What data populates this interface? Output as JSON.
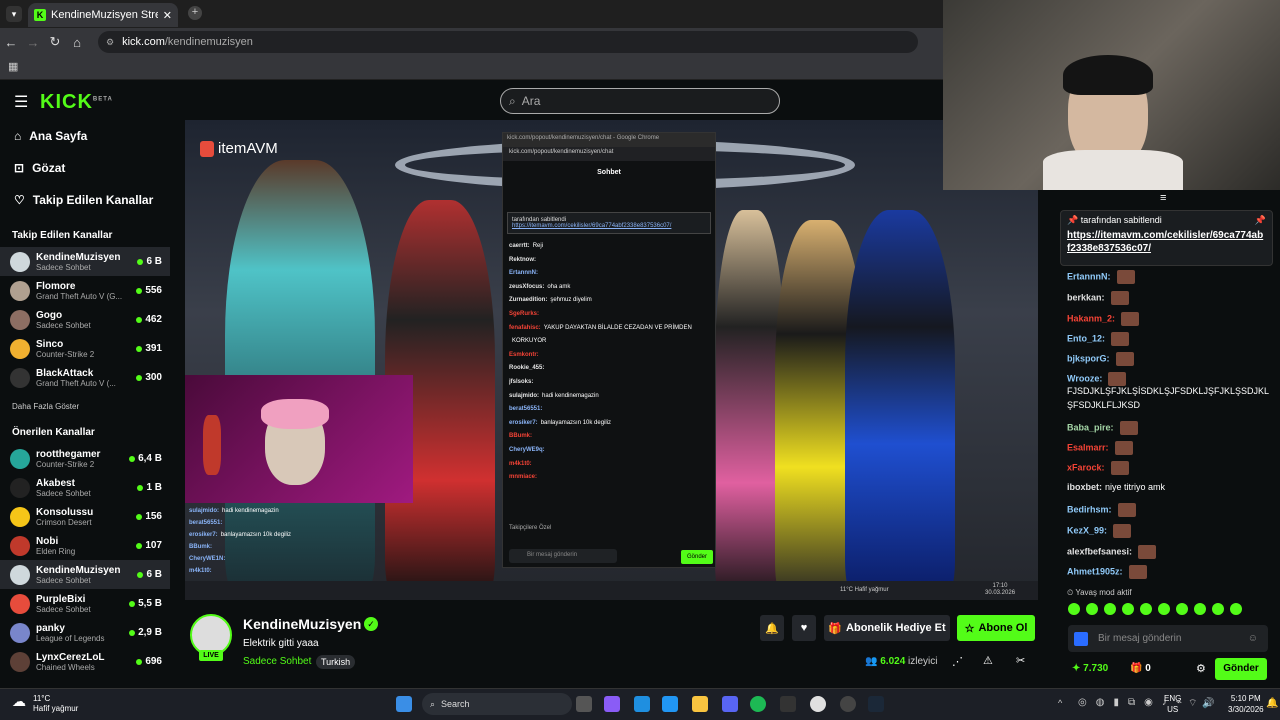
{
  "browser": {
    "tab_title": "KendineMuzisyen Stream - Wat",
    "url_domain": "kick.com",
    "url_path": "/kendinemuzisyen"
  },
  "header": {
    "logo": "KICK",
    "logo_badge": "BETA",
    "search_placeholder": "Ara"
  },
  "sidebar": {
    "nav": [
      {
        "label": "Ana Sayfa",
        "icon": "home-icon"
      },
      {
        "label": "Gözat",
        "icon": "browse-icon"
      },
      {
        "label": "Takip Edilen Kanallar",
        "icon": "heart-icon"
      }
    ],
    "followed_heading": "Takip Edilen Kanallar",
    "followed": [
      {
        "name": "KendineMuzisyen",
        "game": "Sadece Sohbet",
        "viewers": "6 B",
        "color": "#cfd8dc",
        "active": true
      },
      {
        "name": "Flomore",
        "game": "Grand Theft Auto V (G...",
        "viewers": "556",
        "color": "#b0a090"
      },
      {
        "name": "Gogo",
        "game": "Sadece Sohbet",
        "viewers": "462",
        "color": "#8d6e63"
      },
      {
        "name": "Sinco",
        "game": "Counter-Strike 2",
        "viewers": "391",
        "color": "#f0b030"
      },
      {
        "name": "BlackAttack",
        "game": "Grand Theft Auto V (...",
        "viewers": "300",
        "color": "#333333"
      }
    ],
    "more_label": "Daha Fazla Göster",
    "recommended_heading": "Önerilen Kanallar",
    "recommended": [
      {
        "name": "rootthegamer",
        "game": "Counter-Strike 2",
        "viewers": "6,4 B",
        "color": "#26a69a"
      },
      {
        "name": "Akabest",
        "game": "Sadece Sohbet",
        "viewers": "1 B",
        "color": "#222222"
      },
      {
        "name": "Konsolussu",
        "game": "Crimson Desert",
        "viewers": "156",
        "color": "#f5c518"
      },
      {
        "name": "Nobi",
        "game": "Elden Ring",
        "viewers": "107",
        "color": "#c0392b"
      },
      {
        "name": "KendineMuzisyen",
        "game": "Sadece Sohbet",
        "viewers": "6 B",
        "color": "#cfd8dc",
        "active": true
      },
      {
        "name": "PurpleBixi",
        "game": "Sadece Sohbet",
        "viewers": "5,5 B",
        "color": "#e74c3c"
      },
      {
        "name": "panky",
        "game": "League of Legends",
        "viewers": "2,9 B",
        "color": "#7986cb"
      },
      {
        "name": "LynxCerezLoL",
        "game": "Chained Wheels",
        "viewers": "696",
        "color": "#5d4037"
      }
    ]
  },
  "video": {
    "brand": "itemAVM",
    "popout": {
      "title": "kick.com/popout/kendinemuzisyen/chat - Google Chrome",
      "url": "kick.com/popout/kendinemuzisyen/chat",
      "heading": "Sohbet",
      "pinned_by": "tarafından sabitlendi",
      "pinned_link": "https://itemavm.com/cekilisler/69ca774abf2338e837536c07/",
      "messages": [
        {
          "user": "caerrtt:",
          "text": "Reji",
          "color": "#e5e5e5"
        },
        {
          "user": "Rektnow:",
          "text": "",
          "color": "#e5e5e5"
        },
        {
          "user": "ErtannnN:",
          "text": "",
          "color": "#8ab4f8"
        },
        {
          "user": "zeusXfocus:",
          "text": "oha amk",
          "color": "#e5e5e5"
        },
        {
          "user": "Zurnaedition:",
          "text": "şehmuz diyelim",
          "color": "#e5e5e5"
        },
        {
          "user": "SgeRurks:",
          "text": "",
          "color": "#f44336"
        },
        {
          "user": "fenafahisc:",
          "text": "YAKUP DAYAKTAN BİLALDE CEZADAN VE PRİMDEN",
          "color": "#f44336"
        },
        {
          "user": "",
          "text": "KORKUYOR",
          "color": "#e5e5e5"
        },
        {
          "user": "Esmkontr:",
          "text": "",
          "color": "#f44336"
        },
        {
          "user": "Rookie_455:",
          "text": "",
          "color": "#e5e5e5"
        },
        {
          "user": "jfslsoks:",
          "text": "",
          "color": "#e5e5e5"
        },
        {
          "user": "sulajmido:",
          "text": "hadi kendinemagazin",
          "color": "#e5e5e5"
        },
        {
          "user": "berat56551:",
          "text": "",
          "color": "#8ab4f8"
        },
        {
          "user": "erosiker7:",
          "text": "banlayamazsın 10k degiliz",
          "color": "#8ab4f8"
        },
        {
          "user": "BBumk:",
          "text": "",
          "color": "#f44336"
        },
        {
          "user": "CheryWE9q:",
          "text": "",
          "color": "#8ab4f8"
        },
        {
          "user": "m4k1t0:",
          "text": "",
          "color": "#f44336"
        },
        {
          "user": "mnmiace:",
          "text": "",
          "color": "#f44336"
        }
      ],
      "input_placeholder": "Bir mesaj gönderin",
      "send": "Gönder",
      "subs_label": "Takipçilere Özel"
    },
    "overlay_chat": [
      {
        "user": "sulajmido:",
        "text": "hadi kendinemagazin"
      },
      {
        "user": "berat56551:",
        "text": ""
      },
      {
        "user": "erosiker7:",
        "text": "banlayamazsın 10k degiliz"
      },
      {
        "user": "BBumk:",
        "text": ""
      },
      {
        "user": "CheryWE1N:",
        "text": ""
      },
      {
        "user": "m4k1t0:",
        "text": ""
      }
    ],
    "inner_taskbar": {
      "weather": "11°C   Hafif yağmur",
      "time": "17:10",
      "date": "30.03.2026"
    }
  },
  "stream": {
    "name": "KendineMuzisyen",
    "live": "LIVE",
    "title": "Elektrik gitti yaaa",
    "category": "Sadece Sohbet",
    "tag": "Turkish",
    "gift_sub": "Abonelik Hediye Et",
    "subscribe": "Abone Ol",
    "viewers": "6.024",
    "viewers_label": "izleyici"
  },
  "chat": {
    "pinned_by": "tarafından sabitlendi",
    "pinned_link": "https://itemavm.com/cekilisler/69ca774abf2338e837536c07/",
    "messages": [
      {
        "user": "ErtannnN:",
        "text": "",
        "color": "#90caf9",
        "top": 0
      },
      {
        "user": "berkkan:",
        "text": "",
        "color": "#e0e0e0"
      },
      {
        "user": "Hakanm_2:",
        "text": "",
        "color": "#f44336"
      },
      {
        "user": "Ento_12:",
        "text": "",
        "color": "#90caf9"
      },
      {
        "user": "bjksporG:",
        "text": "",
        "color": "#90caf9"
      },
      {
        "user": "Wrooze:",
        "text": "",
        "color": "#90caf9"
      },
      {
        "user": "",
        "text": "FJSDJKLŞFJKLŞİSDKLŞJFSDKLJŞFJKLŞSDJKL",
        "color": "#e0e0e0"
      },
      {
        "user": "",
        "text": "ŞFSDJKLFLJKSD",
        "color": "#e0e0e0"
      },
      {
        "user": "Baba_pire:",
        "text": "",
        "color": "#a5d6a7"
      },
      {
        "user": "Esalmarr:",
        "text": "",
        "color": "#f44336"
      },
      {
        "user": "xFarock:",
        "text": "",
        "color": "#f44336"
      },
      {
        "user": "iboxbet:",
        "text": "niye titriyo amk",
        "color": "#e0e0e0"
      },
      {
        "user": "Bedirhsm:",
        "text": "",
        "color": "#90caf9"
      },
      {
        "user": "KezX_99:",
        "text": "",
        "color": "#90caf9"
      },
      {
        "user": "alexfbefsanesi:",
        "text": "",
        "color": "#e0e0e0"
      },
      {
        "user": "Ahmet1905z:",
        "text": "",
        "color": "#90caf9"
      }
    ],
    "slow_mode": "Yavaş mod aktif",
    "input_placeholder": "Bir mesaj gönderin",
    "points": "7.730",
    "gifts": "0",
    "send": "Gönder"
  },
  "taskbar": {
    "weather_temp": "11°C",
    "weather_desc": "Hafif yağmur",
    "search": "Search",
    "lang1": "ENG",
    "lang2": "US",
    "time": "5:10 PM",
    "date": "3/30/2026"
  }
}
